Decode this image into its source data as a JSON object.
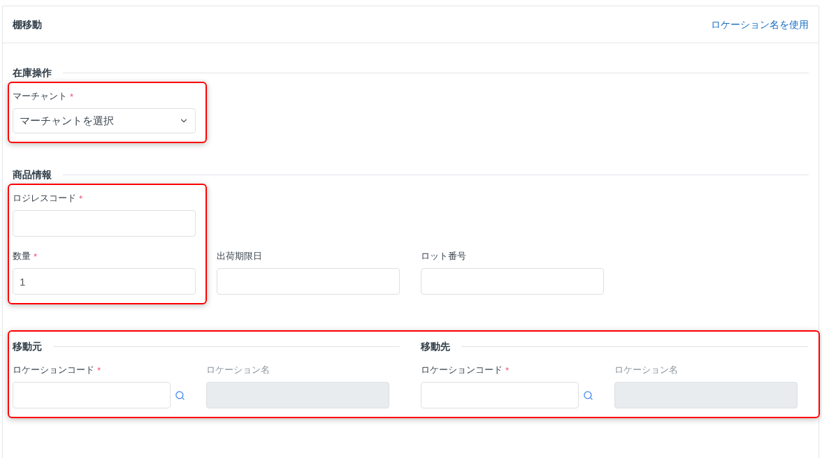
{
  "header": {
    "title": "棚移動",
    "link": "ロケーション名を使用"
  },
  "sections": [
    {
      "kind": "stacked",
      "title": "在庫操作",
      "groups": [
        {
          "highlighted": true,
          "fields": [
            {
              "kind": "select",
              "label": "マーチャント",
              "required_mark": "*",
              "value": "マーチャントを選択"
            }
          ]
        }
      ]
    },
    {
      "kind": "stacked",
      "title": "商品情報",
      "groups": [
        {
          "highlighted": true,
          "fields": [
            {
              "kind": "input",
              "label": "ロジレスコード",
              "required_mark": "*",
              "disabled": false
            },
            {
              "kind": "input",
              "label": "数量",
              "required_mark": "*",
              "disabled": false,
              "value": "1"
            }
          ]
        },
        {
          "fields": [
            {
              "kind": "input",
              "label": "出荷期限日",
              "disabled": false
            }
          ]
        },
        {
          "fields": [
            {
              "kind": "input",
              "label": "ロット番号",
              "disabled": false
            }
          ]
        }
      ]
    },
    {
      "kind": "split",
      "highlighted": true,
      "halves": [
        {
          "title": "移動元",
          "fields": [
            {
              "kind": "lookup",
              "label": "ロケーションコード",
              "required_mark": "*"
            },
            {
              "kind": "input",
              "label": "ロケーション名",
              "disabled": true
            }
          ]
        },
        {
          "title": "移動先",
          "fields": [
            {
              "kind": "lookup",
              "label": "ロケーションコード",
              "required_mark": "*"
            },
            {
              "kind": "input",
              "label": "ロケーション名",
              "disabled": true
            }
          ]
        }
      ]
    }
  ]
}
